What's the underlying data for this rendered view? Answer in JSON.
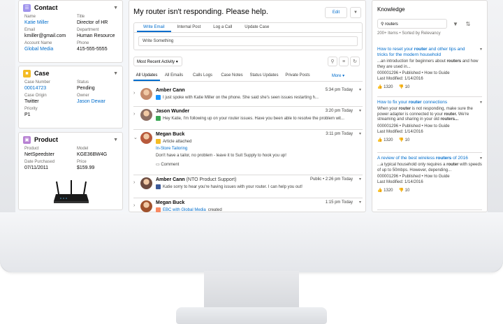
{
  "contact": {
    "title": "Contact",
    "fields": [
      {
        "label": "Name",
        "value": "Katie Miller",
        "link": true
      },
      {
        "label": "Title",
        "value": "Director of HR",
        "link": false
      },
      {
        "label": "Email",
        "value": "kmiller@gmail.com",
        "link": false
      },
      {
        "label": "Department",
        "value": "Human Resource",
        "link": false
      },
      {
        "label": "Account Name",
        "value": "Global Media",
        "link": true
      },
      {
        "label": "Phone",
        "value": "415-555-5555",
        "link": false
      }
    ]
  },
  "case": {
    "title": "Case",
    "fields": [
      {
        "label": "Case Number",
        "value": "00014723",
        "link": true
      },
      {
        "label": "Status",
        "value": "Pending",
        "link": false
      },
      {
        "label": "Case Origin",
        "value": "Twitter",
        "link": false
      },
      {
        "label": "Owner",
        "value": "Jason Dewar",
        "link": true
      },
      {
        "label": "Priority",
        "value": "P1",
        "link": false
      }
    ]
  },
  "product": {
    "title": "Product",
    "fields": [
      {
        "label": "Product",
        "value": "NetSpeedster",
        "link": false
      },
      {
        "label": "Model",
        "value": "KGE36BW4G",
        "link": false
      },
      {
        "label": "Date Purchased",
        "value": "07/11/2011",
        "link": false
      },
      {
        "label": "Price",
        "value": "$159.99",
        "link": false
      }
    ]
  },
  "feed": {
    "case_title": "My router isn't responding. Please help.",
    "edit_label": "Edit",
    "publisher_tabs": [
      "Write Email",
      "Internal Post",
      "Log a Call",
      "Update Case"
    ],
    "publisher_placeholder": "Write Something",
    "sort_label": "Most Recent Activity",
    "filter_tabs": [
      "All Updates",
      "All Emails",
      "Calls Logs",
      "Case Notes",
      "Status Updates",
      "Private Posts",
      "More"
    ],
    "posts": [
      {
        "author": "Amber Cann",
        "suffix": "",
        "time": "5:34 pm Today",
        "text": "I just spoke with Katie Miller on the phone. She said she's seen issues restarting h...",
        "icon_color": "#1b96ff"
      },
      {
        "author": "Jason Wunder",
        "suffix": "",
        "time": "3:20 pm Today",
        "text": "Hey Katie, I'm following up on your router issues. Have you been able to resolve the problem wit...",
        "icon_color": "#3ba755"
      },
      {
        "author": "Megan Buck",
        "suffix": "",
        "time": "3:11 pm Today",
        "text": "Article attached",
        "icon_color": "#f4bc25",
        "attachment": "In-Store Tailoring",
        "comment": "Don't have a tailor, no problem - leave it to Suit Supply to hook you up!",
        "comment_label": "Comment"
      },
      {
        "author": "Amber Cann",
        "suffix": "(NTO Product Support)",
        "time": "Public • 2:26 pm Today",
        "text": "Katie sorry to hear you're having issues with your router. I can help you out!",
        "icon_color": "#3b5998"
      },
      {
        "author": "Megan Buck",
        "suffix": "",
        "time": "1:15 pm Today",
        "text_link": "EBC with Global Media",
        "text": "created",
        "icon_color": "#f88962"
      }
    ]
  },
  "knowledge": {
    "title": "Knowledge",
    "search_value": "routers",
    "count": "200+ Items • Sorted by Relevancy",
    "articles": [
      {
        "title": "How to reset your router and other tips and tricks for the modern household",
        "desc": "...an introduction for beginners about routers and how they are used in...",
        "meta": "000001296 • Published • How to Guide",
        "date": "Last Modified: 1/14/2016",
        "likes": "1320",
        "dislikes": "10"
      },
      {
        "title": "How to fix your router connections",
        "desc": "When your router is not responding, make sure the power adapter is connected to your router. We're streaming and sharing in your old routers...",
        "meta": "000001296 • Published • How to Guide",
        "date": "Last Modified: 1/14/2016",
        "likes": "1320",
        "dislikes": "10"
      },
      {
        "title": "A review of the best wireless routers of 2016",
        "desc": "...a typical household only requires a router with speeds of up to 50mbps. However, depending...",
        "meta": "000001296 • Published • How to Guide",
        "date": "Last Modified: 1/14/2016",
        "likes": "1320",
        "dislikes": "10"
      }
    ]
  }
}
